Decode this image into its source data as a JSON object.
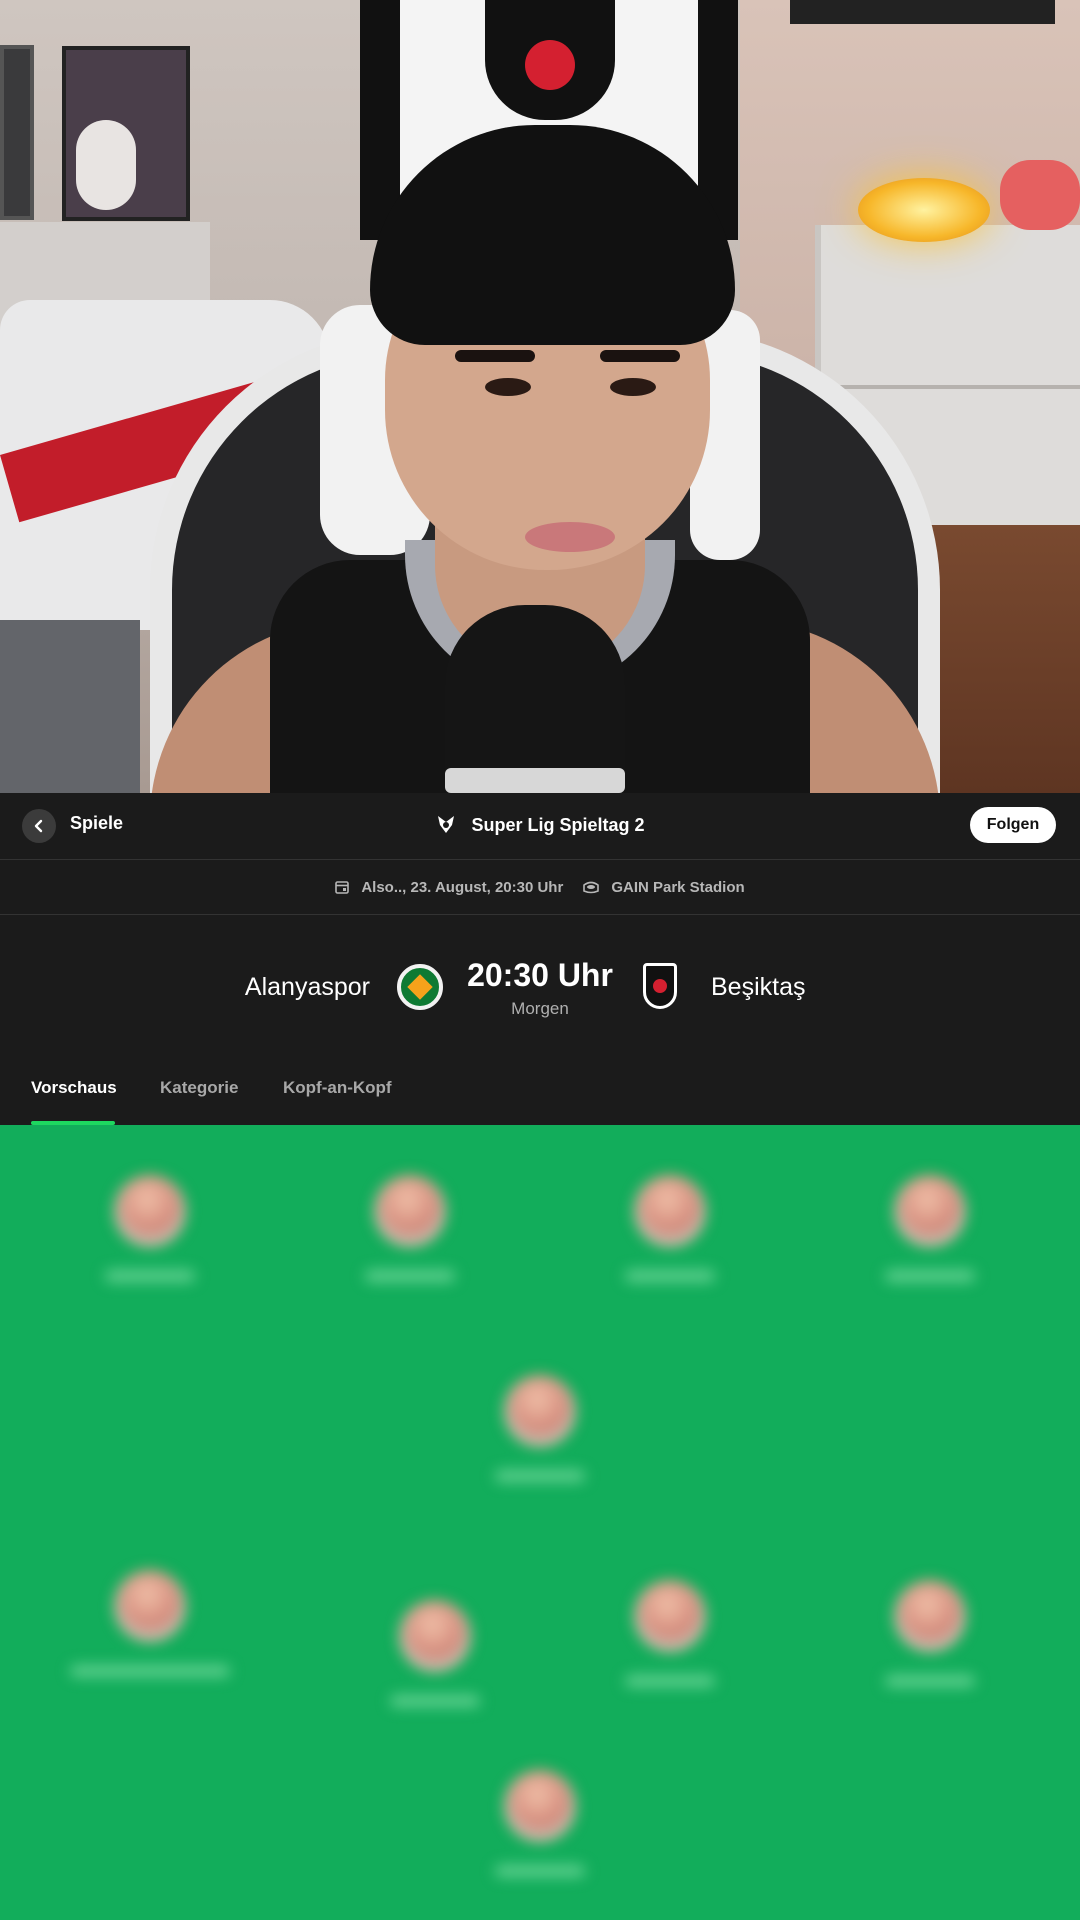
{
  "header": {
    "back_label": "Spiele",
    "league_title": "Super Lig Spieltag 2",
    "follow_label": "Folgen"
  },
  "info": {
    "date": "Also.., 23. August, 20:30 Uhr",
    "stadium": "GAIN Park Stadion"
  },
  "match": {
    "home_team": "Alanyaspor",
    "away_team": "Beşiktaş",
    "kickoff_time": "20:30 Uhr",
    "kickoff_day": "Morgen"
  },
  "tabs": [
    {
      "label": "Vorschaus",
      "active": true
    },
    {
      "label": "Kategorie",
      "active": false
    },
    {
      "label": "Kopf-an-Kopf",
      "active": false
    }
  ],
  "colors": {
    "accent": "#1ed760",
    "pitch": "#12ad5b",
    "background": "#1b1b1b"
  },
  "icons": {
    "back": "chevron-left-icon",
    "league": "super-lig-logo-icon",
    "date": "calendar-icon",
    "stadium": "stadium-icon"
  }
}
